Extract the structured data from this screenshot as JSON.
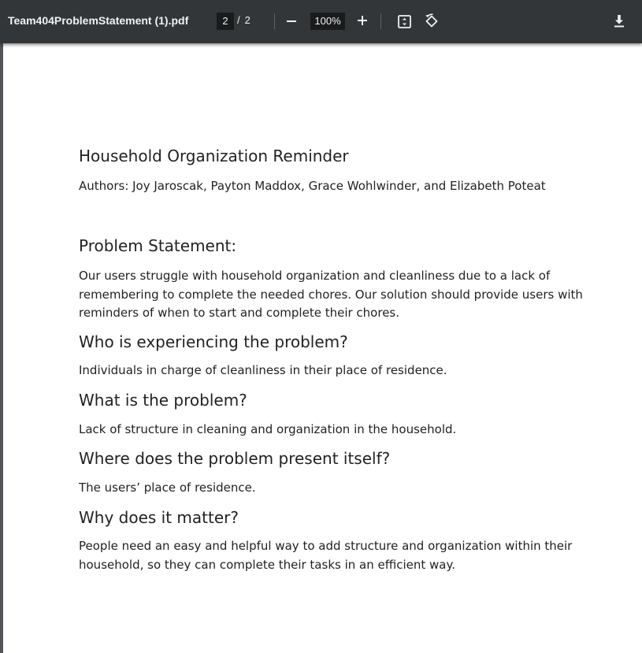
{
  "toolbar": {
    "file_name": "Team404ProblemStatement (1).pdf",
    "current_page": "2",
    "page_separator": "/",
    "total_pages": "2",
    "zoom_level": "100%",
    "icons": {
      "zoom_out": "minus-icon",
      "zoom_in": "plus-icon",
      "fit": "fit-to-page-icon",
      "rotate": "rotate-icon",
      "download": "download-icon"
    },
    "colors": {
      "background": "#323639",
      "text": "#f1f1f1",
      "input": "#191b1c"
    }
  },
  "document": {
    "title": "Household Organization Reminder",
    "authors": "Authors: Joy Jaroscak, Payton Maddox, Grace Wohlwinder, and Elizabeth Poteat",
    "sections": [
      {
        "heading": "Problem Statement:",
        "body": "Our users struggle with household organization and cleanliness due to a lack of remembering to complete the needed chores. Our solution should provide users with reminders of when to start and complete their chores."
      },
      {
        "heading": "Who is experiencing the problem?",
        "body": "Individuals in charge of cleanliness in their place of residence."
      },
      {
        "heading": "What is the problem?",
        "body": "Lack of structure in cleaning and organization in the household."
      },
      {
        "heading": "Where does the problem present itself?",
        "body": "The users’ place of residence."
      },
      {
        "heading": "Why does it matter?",
        "body": "People need an easy and helpful way to add structure and organization within their household, so they can complete their tasks in an efficient way."
      }
    ]
  }
}
